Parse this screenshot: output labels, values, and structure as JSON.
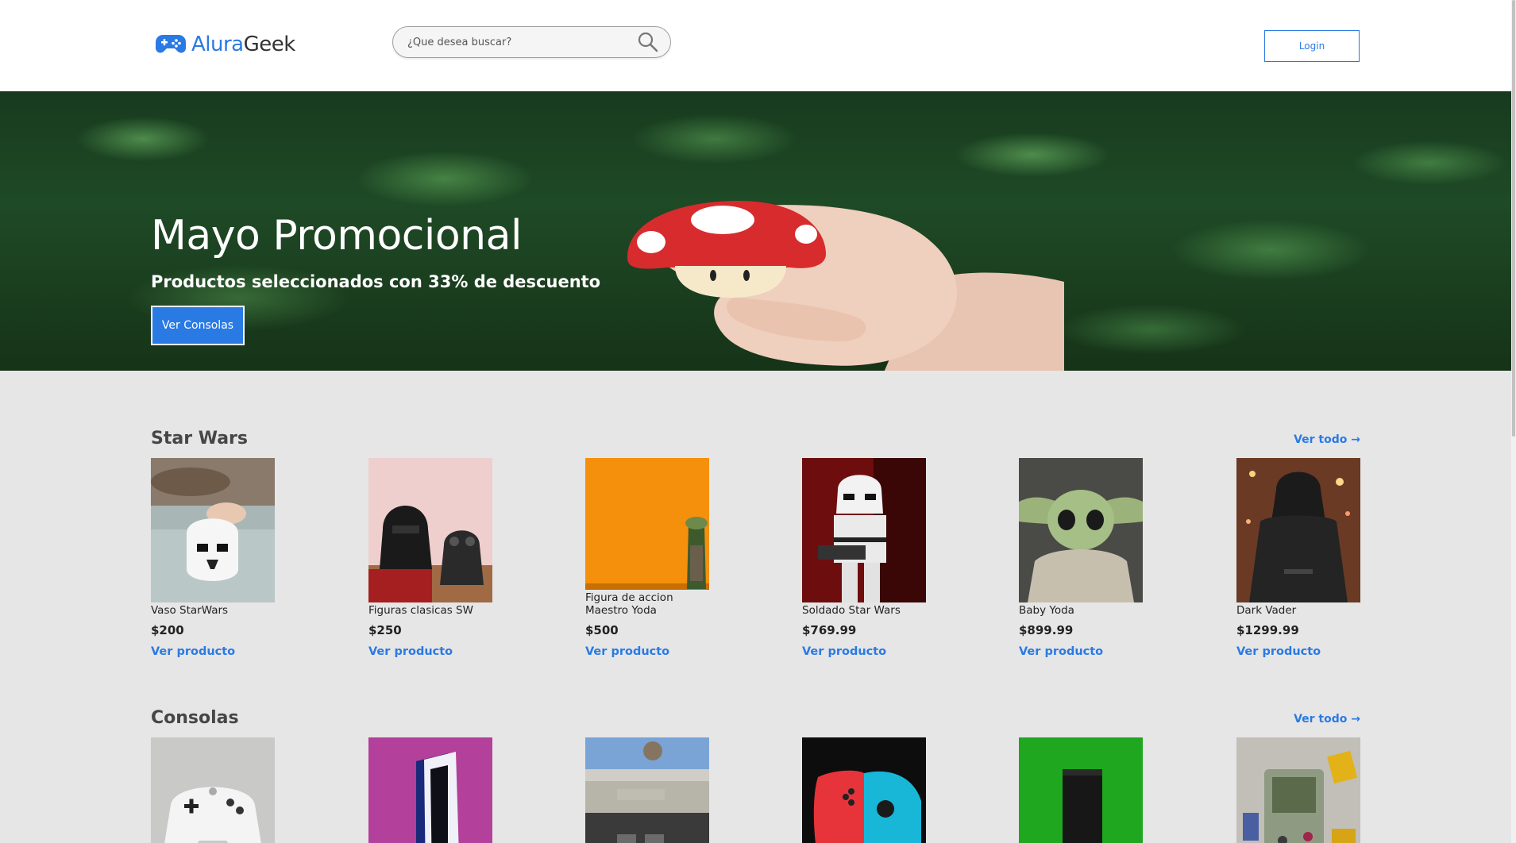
{
  "header": {
    "logo_alura": "Alura",
    "logo_geek": "Geek",
    "search_placeholder": "¿Que desea buscar?",
    "login_label": "Login"
  },
  "hero": {
    "title": "Mayo Promocional",
    "subtitle": "Productos seleccionados con 33% de descuento",
    "button_label": "Ver Consolas"
  },
  "sections": [
    {
      "title": "Star Wars",
      "ver_todo": "Ver todo →",
      "products": [
        {
          "name": "Vaso StarWars",
          "price": "$200",
          "link": "Ver producto"
        },
        {
          "name": "Figuras clasicas SW",
          "price": "$250",
          "link": "Ver producto"
        },
        {
          "name": "Figura de accion Maestro Yoda",
          "price": "$500",
          "link": "Ver producto"
        },
        {
          "name": "Soldado Star Wars",
          "price": "$769.99",
          "link": "Ver producto"
        },
        {
          "name": "Baby Yoda",
          "price": "$899.99",
          "link": "Ver producto"
        },
        {
          "name": "Dark Vader",
          "price": "$1299.99",
          "link": "Ver producto"
        }
      ]
    },
    {
      "title": "Consolas",
      "ver_todo": "Ver todo →",
      "products": [
        {
          "name": "",
          "price": "",
          "link": ""
        },
        {
          "name": "",
          "price": "",
          "link": ""
        },
        {
          "name": "",
          "price": "",
          "link": ""
        },
        {
          "name": "",
          "price": "",
          "link": ""
        },
        {
          "name": "",
          "price": "",
          "link": ""
        },
        {
          "name": "",
          "price": "",
          "link": ""
        }
      ]
    }
  ],
  "colors": {
    "accent": "#2a7ae4",
    "page_bg": "#e6e6e6",
    "text_dark": "#464646"
  },
  "icons": [
    "gamepad-logo-icon",
    "search-icon",
    "arrow-right-icon"
  ]
}
